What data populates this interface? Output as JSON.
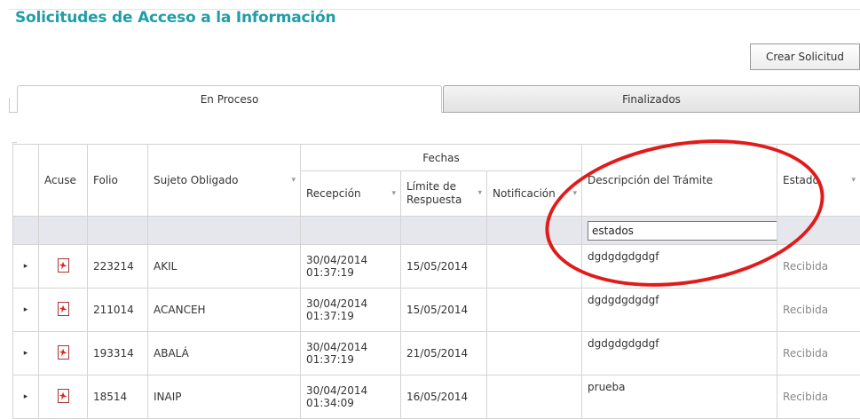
{
  "page": {
    "title": "Solicitudes de Acceso a la Información"
  },
  "toolbar": {
    "create_label": "Crear Solicitud"
  },
  "tabs": [
    {
      "label": "En Proceso",
      "active": true
    },
    {
      "label": "Finalizados",
      "active": false
    }
  ],
  "grid": {
    "group_header": "Fechas",
    "headers": {
      "acuse": "Acuse",
      "folio": "Folio",
      "sujeto": "Sujeto Obligado",
      "recepcion": "Recepción",
      "limite": "Límite de Respuesta",
      "notificacion": "Notificación",
      "descripcion": "Descripción del Trámite",
      "estado": "Estado"
    },
    "filter": {
      "descripcion_value": "estados"
    },
    "rows": [
      {
        "folio": "223214",
        "sujeto": "AKIL",
        "recepcion_date": "30/04/2014",
        "recepcion_time": "01:37:19",
        "limite": "15/05/2014",
        "notificacion": "",
        "descripcion": "dgdgdgdgdgf",
        "estado": "Recibida"
      },
      {
        "folio": "211014",
        "sujeto": "ACANCEH",
        "recepcion_date": "30/04/2014",
        "recepcion_time": "01:37:19",
        "limite": "15/05/2014",
        "notificacion": "",
        "descripcion": "dgdgdgdgdgf",
        "estado": "Recibida"
      },
      {
        "folio": "193314",
        "sujeto": "ABALÁ",
        "recepcion_date": "30/04/2014",
        "recepcion_time": "01:37:19",
        "limite": "21/05/2014",
        "notificacion": "",
        "descripcion": "dgdgdgdgdgf",
        "estado": "Recibida"
      },
      {
        "folio": "18514",
        "sujeto": "INAIP",
        "recepcion_date": "30/04/2014",
        "recepcion_time": "01:34:09",
        "limite": "16/05/2014",
        "notificacion": "",
        "descripcion": "prueba",
        "estado": "Recibida"
      }
    ]
  },
  "icons": {
    "expand": "▸",
    "filter": "▾",
    "acuse": "pdf-icon"
  },
  "colors": {
    "title": "#1f9ea8",
    "highlight": "#e11a1a",
    "filter_row_bg": "#e6e7ec"
  }
}
